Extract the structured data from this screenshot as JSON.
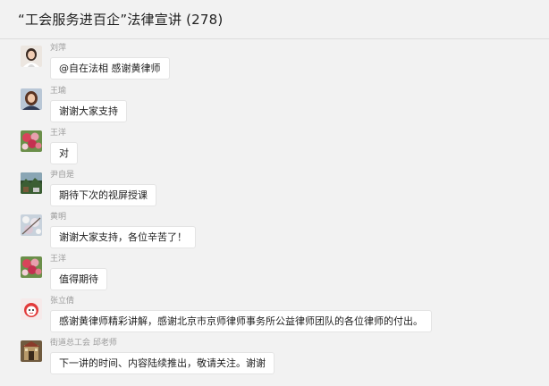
{
  "chat": {
    "title": "“工会服务进百企”法律宣讲 (278)"
  },
  "messages": [
    {
      "sender": "刘萍",
      "text": "@自在法相 感谢黄律师",
      "avatar": "portrait-woman-icon"
    },
    {
      "sender": "王瑜",
      "text": "谢谢大家支持",
      "avatar": "portrait-woman-icon"
    },
    {
      "sender": "王洋",
      "text": "对",
      "avatar": "flowers-icon"
    },
    {
      "sender": "尹自是",
      "text": "期待下次的视屏授课",
      "avatar": "landscape-icon"
    },
    {
      "sender": "黄明",
      "text": "谢谢大家支持，各位辛苦了！",
      "avatar": "blossom-icon"
    },
    {
      "sender": "王洋",
      "text": "值得期待",
      "avatar": "flowers-icon"
    },
    {
      "sender": "张立倩",
      "text": "感谢黄律师精彩讲解，感谢北京市京师律师事务所公益律师团队的各位律师的付出。",
      "avatar": "cartoon-icon"
    },
    {
      "sender": "街道总工会 邱老师",
      "text": "下一讲的时间、内容陆续推出，敬请关注。谢谢",
      "avatar": "building-icon"
    }
  ]
}
